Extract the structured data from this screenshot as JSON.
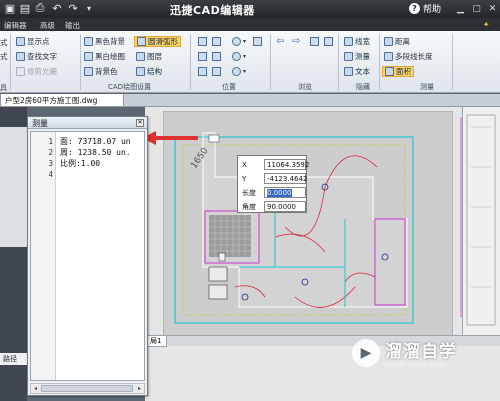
{
  "app": {
    "title": "迅捷CAD编辑器",
    "help_label": "帮助"
  },
  "menu": [
    "编辑器",
    "高级",
    "输出"
  ],
  "ribbon": {
    "view": [
      "显示点",
      "查找文字",
      "修剪光栅"
    ],
    "cad_settings": [
      "黑色背景",
      "黑白绘图",
      "背景色",
      "圆滑弧形",
      "图层",
      "结构"
    ],
    "right": [
      "线宽",
      "测量",
      "文本",
      "距离",
      "多段线长度",
      "面积"
    ],
    "left_fragments": [
      "式",
      "式",
      "具"
    ],
    "groups": {
      "cad_settings": "CAD绘图设置",
      "position": "位置",
      "browse": "浏览",
      "hide": "隐藏",
      "measure": "测量"
    }
  },
  "document_tab": "户型2房60平方施工图.dwg",
  "left_panel_tab": "路径",
  "bottom_tab": "局1",
  "measure_dialog": {
    "title": "测量",
    "lines": [
      {
        "n": "1",
        "text": "面: 73718.07 un"
      },
      {
        "n": "2",
        "text": "周: 1238.50 un."
      },
      {
        "n": "3",
        "text": "比例:1.00"
      },
      {
        "n": "4",
        "text": ""
      }
    ]
  },
  "coord_input": {
    "x_label": "X",
    "x_value": "11064.3592",
    "y_label": "Y",
    "y_value": "-4123.4642",
    "length_label": "长度",
    "length_value": "0.0000",
    "angle_label": "角度",
    "angle_value": "90.0000"
  },
  "drawing_annotation": "1650",
  "watermark": {
    "main": "溜溜自学",
    "sub": "ZIXUE.3D66.COM"
  },
  "colors": {
    "arrow": "#e0302f",
    "highlight": "#fbd46a",
    "plan_cyan": "#22c6d6",
    "plan_red": "#d8213a",
    "plan_magenta": "#cc33cc",
    "plan_yellow": "#c8c800"
  }
}
